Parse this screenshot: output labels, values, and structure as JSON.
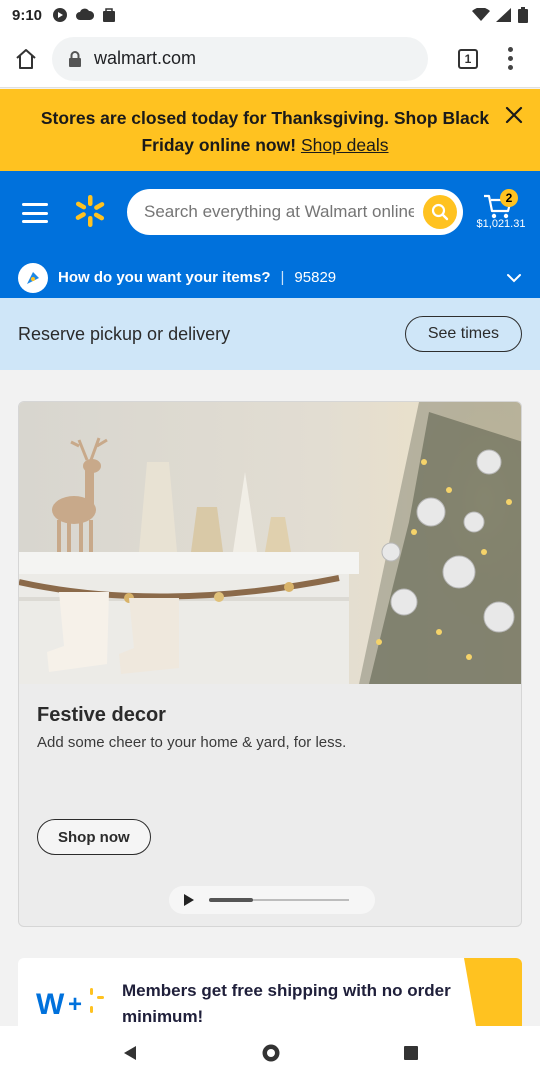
{
  "status_bar": {
    "time": "9:10"
  },
  "browser": {
    "url": "walmart.com",
    "tab_count": "1"
  },
  "promo": {
    "text": "Stores are closed today for Thanksgiving. Shop Black Friday online now!",
    "link": "Shop deals"
  },
  "header": {
    "search_placeholder": "Search everything at Walmart online",
    "cart_count": "2",
    "cart_total": "$1,021.31"
  },
  "delivery": {
    "question": "How do you want your items?",
    "separator": "|",
    "zip": "95829"
  },
  "reserve": {
    "text": "Reserve pickup or delivery",
    "button": "See times"
  },
  "feature_card": {
    "title": "Festive decor",
    "description": "Add some cheer to your home & yard, for less.",
    "button": "Shop now"
  },
  "members": {
    "text": "Members get free shipping with no order minimum!"
  },
  "colors": {
    "walmart_blue": "#0071dc",
    "spark_yellow": "#ffc220",
    "reserve_bg": "#cfe6f8"
  }
}
